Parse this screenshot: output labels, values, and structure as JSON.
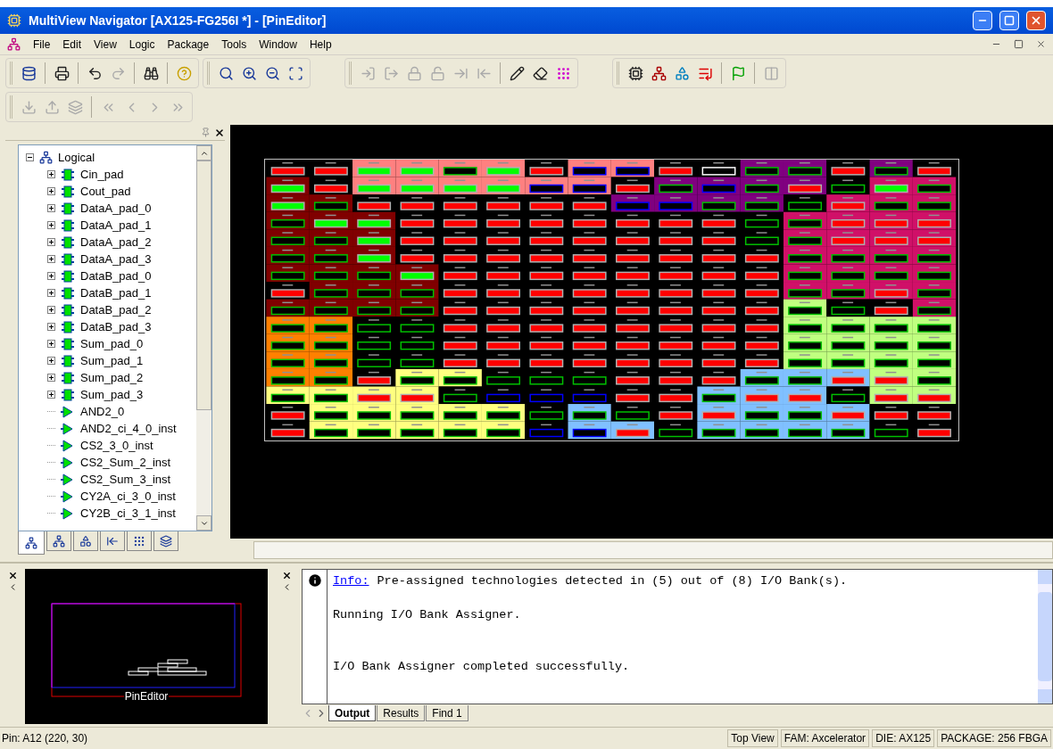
{
  "window": {
    "title": "MultiView Navigator [AX125-FG256I *] - [PinEditor]"
  },
  "menu": [
    "File",
    "Edit",
    "View",
    "Logic",
    "Package",
    "Tools",
    "Window",
    "Help"
  ],
  "tree": {
    "label": "Logical",
    "expanded": true,
    "children": [
      {
        "label": "Cin_pad",
        "kind": "pad",
        "expanded": false
      },
      {
        "label": "Cout_pad",
        "kind": "pad",
        "expanded": false
      },
      {
        "label": "DataA_pad_0",
        "kind": "pad",
        "expanded": false
      },
      {
        "label": "DataA_pad_1",
        "kind": "pad",
        "expanded": false
      },
      {
        "label": "DataA_pad_2",
        "kind": "pad",
        "expanded": false
      },
      {
        "label": "DataA_pad_3",
        "kind": "pad",
        "expanded": false
      },
      {
        "label": "DataB_pad_0",
        "kind": "pad",
        "expanded": false
      },
      {
        "label": "DataB_pad_1",
        "kind": "pad",
        "expanded": false
      },
      {
        "label": "DataB_pad_2",
        "kind": "pad",
        "expanded": false
      },
      {
        "label": "DataB_pad_3",
        "kind": "pad",
        "expanded": false
      },
      {
        "label": "Sum_pad_0",
        "kind": "pad",
        "expanded": false
      },
      {
        "label": "Sum_pad_1",
        "kind": "pad",
        "expanded": false
      },
      {
        "label": "Sum_pad_2",
        "kind": "pad",
        "expanded": false
      },
      {
        "label": "Sum_pad_3",
        "kind": "pad",
        "expanded": false
      },
      {
        "label": "AND2_0",
        "kind": "gate"
      },
      {
        "label": "AND2_ci_4_0_inst",
        "kind": "gate"
      },
      {
        "label": "CS2_3_0_inst",
        "kind": "gate"
      },
      {
        "label": "CS2_Sum_2_inst",
        "kind": "gate"
      },
      {
        "label": "CS2_Sum_3_inst",
        "kind": "gate"
      },
      {
        "label": "CY2A_ci_3_0_inst",
        "kind": "gate"
      },
      {
        "label": "CY2B_ci_3_1_inst",
        "kind": "gate"
      }
    ]
  },
  "tree_tabs": [
    {
      "selected": true
    },
    {
      "selected": false
    },
    {
      "selected": false
    },
    {
      "selected": false
    },
    {
      "selected": false
    },
    {
      "selected": false
    }
  ],
  "overview": {
    "label": "PinEditor"
  },
  "output": {
    "messages": [
      {
        "kind": "info",
        "label": "Info:",
        "text": "Pre-assigned technologies detected in (5) out of (8) I/O Bank(s)."
      },
      {
        "kind": "plain",
        "text": "Running I/O Bank Assigner."
      },
      {
        "kind": "plain",
        "text": "I/O Bank Assigner completed successfully."
      }
    ],
    "tabs": [
      {
        "label": "Output",
        "selected": true
      },
      {
        "label": "Results",
        "selected": false
      },
      {
        "label": "Find 1",
        "selected": false
      }
    ]
  },
  "status_bar": {
    "pin": "Pin: A12 (220, 30)",
    "fields": [
      "Top View",
      "FAM: Axcelerator",
      "DIE: AX125",
      "PACKAGE: 256 FBGA"
    ]
  }
}
